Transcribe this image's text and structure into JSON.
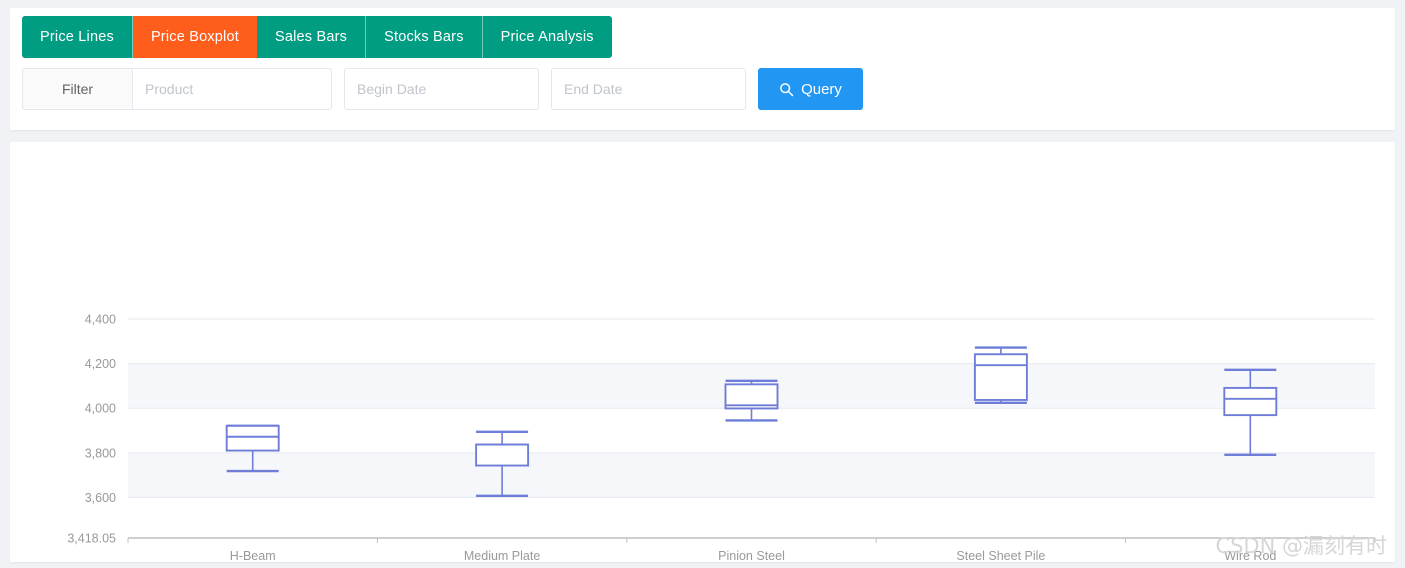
{
  "tabs": [
    {
      "label": "Price Lines",
      "active": false
    },
    {
      "label": "Price Boxplot",
      "active": true
    },
    {
      "label": "Sales Bars",
      "active": false
    },
    {
      "label": "Stocks Bars",
      "active": false
    },
    {
      "label": "Price Analysis",
      "active": false
    }
  ],
  "colors": {
    "tab_normal": "#009d83",
    "tab_active": "#ff5d1c",
    "query_button": "#2196f3",
    "box_stroke": "#6e7ed8",
    "band": "#f5f7fa",
    "gridline": "#e6e9f0",
    "axis": "#999999"
  },
  "filter": {
    "label": "Filter",
    "product_placeholder": "Product",
    "product_value": "",
    "begin_date_placeholder": "Begin Date",
    "begin_date_value": "",
    "end_date_placeholder": "End Date",
    "end_date_value": "",
    "query_label": "Query",
    "query_icon": "search-icon"
  },
  "watermark": "CSDN @漏刻有时",
  "chart_data": {
    "type": "boxplot",
    "title": "",
    "xlabel": "",
    "ylabel": "",
    "grid": true,
    "legend": "none",
    "categories": [
      "H-Beam",
      "Medium Plate",
      "Pinion Steel",
      "Steel Sheet Pile",
      "Wire Rod"
    ],
    "y_ticks": [
      "3,418.05",
      "3,600",
      "3,800",
      "4,000",
      "4,200",
      "4,400"
    ],
    "y_tick_values": [
      3418.05,
      3600,
      3800,
      4000,
      4200,
      4400
    ],
    "ylim": [
      3418.05,
      4462
    ],
    "series": [
      {
        "name": "H-Beam",
        "min": 3718,
        "q1": 3810,
        "median": 3872,
        "q3": 3921,
        "max": 3921
      },
      {
        "name": "Medium Plate",
        "min": 3607,
        "q1": 3743,
        "median": 3837,
        "q3": 3837,
        "max": 3894
      },
      {
        "name": "Pinion Steel",
        "min": 3945,
        "q1": 3999,
        "median": 4013,
        "q3": 4107,
        "max": 4123
      },
      {
        "name": "Steel Sheet Pile",
        "min": 4024,
        "q1": 4037,
        "median": 4193,
        "q3": 4242,
        "max": 4272
      },
      {
        "name": "Wire Rod",
        "min": 3791,
        "q1": 3969,
        "median": 4042,
        "q3": 4091,
        "max": 4172
      }
    ]
  }
}
